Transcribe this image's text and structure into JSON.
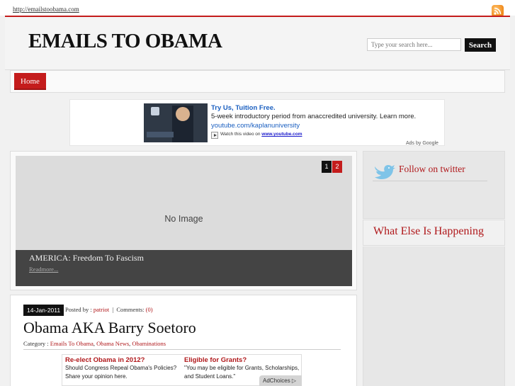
{
  "top": {
    "url": "http://emailstoobama.com",
    "rss_icon": "rss-icon"
  },
  "header": {
    "site_title": "EMAILS TO OBAMA"
  },
  "search": {
    "placeholder": "Type your search here...",
    "button": "Search"
  },
  "nav": {
    "items": [
      "Home"
    ]
  },
  "ad_banner": {
    "title": "Try Us, Tuition Free.",
    "description": "5-week introductory period from anaccredited university. Learn more.",
    "url": "youtube.com/kaplanuniversity",
    "watch_prefix": "Watch this video on",
    "watch_link": "www.youtube.com",
    "ads_by": "Ads by Google"
  },
  "slider": {
    "no_image": "No Image",
    "pages": [
      "1",
      "2"
    ],
    "active_page": "1",
    "caption_title": "AMERICA: Freedom To Fascism",
    "caption_more": "Readmore..."
  },
  "sidebar": {
    "twitter_label": "Follow on twitter",
    "happening_title": "What Else Is Happening"
  },
  "post": {
    "date": "14-Jan-2011",
    "posted_by_label": "Posted by :",
    "author": "patriot",
    "comments_label": "Comments:",
    "comments_count": "(0)",
    "title": "Obama AKA Barry Soetoro",
    "category_label": "Category :",
    "categories": [
      "Emails To Obama",
      "Obama News",
      "Obaminations"
    ]
  },
  "ad_inline": {
    "left": {
      "title": "Re-elect Obama in 2012?",
      "line1": "Should Congress Repeal Obama's Policies?",
      "line2": "Share your opinion here."
    },
    "right": {
      "title": "Eligible for Grants?",
      "line1": "\"You may be eligible for Grants, Scholarships,",
      "line2": "and Student Loans.\""
    },
    "adchoices": "AdChoices"
  },
  "colors": {
    "accent": "#c41c1c",
    "text_red": "#b0181b",
    "link_blue": "#1a5fc0"
  }
}
